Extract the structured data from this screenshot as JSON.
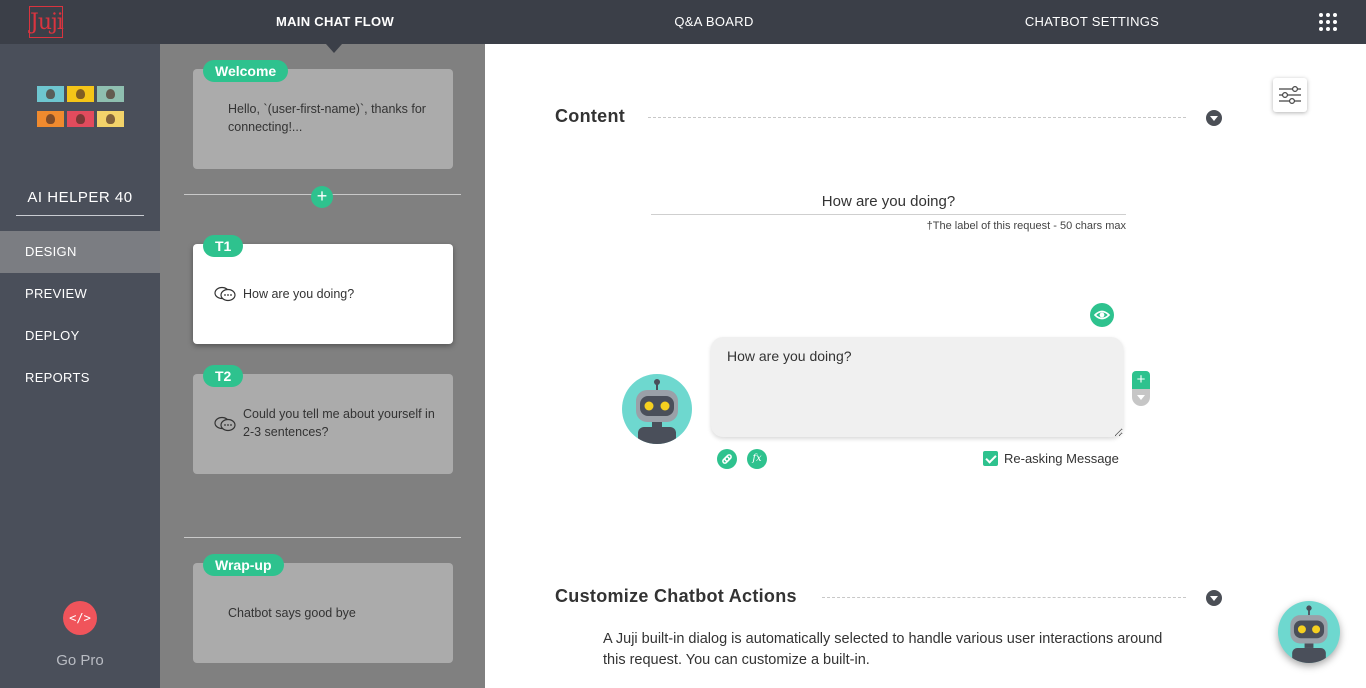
{
  "app": {
    "logo_text": "Juji"
  },
  "topnav": {
    "tabs": [
      {
        "label": "MAIN CHAT FLOW",
        "active": true
      },
      {
        "label": "Q&A BOARD",
        "active": false
      },
      {
        "label": "CHATBOT SETTINGS",
        "active": false
      }
    ],
    "apps_icon": "apps-grid-icon"
  },
  "sidebar": {
    "bot_name": "AI HELPER 40",
    "items": [
      {
        "label": "DESIGN",
        "active": true
      },
      {
        "label": "PREVIEW",
        "active": false
      },
      {
        "label": "DEPLOY",
        "active": false
      },
      {
        "label": "REPORTS",
        "active": false
      }
    ],
    "gopro": {
      "icon_text": "</>",
      "label": "Go Pro"
    },
    "avatar_colors": [
      "#6ec6d0",
      "#f5c518",
      "#8fbfb0",
      "#f08a2e",
      "#e24b5d",
      "#f3d36a"
    ]
  },
  "flow": {
    "cards": [
      {
        "tag": "Welcome",
        "text": "Hello, `(user-first-name)`, thanks for connecting!...",
        "has_chat_icon": false,
        "selected": false
      },
      {
        "tag": "T1",
        "text": "How are you doing?",
        "has_chat_icon": true,
        "selected": true
      },
      {
        "tag": "T2",
        "text": "Could you tell me about yourself in 2-3 sentences?",
        "has_chat_icon": true,
        "selected": false
      },
      {
        "tag": "Wrap-up",
        "text": "Chatbot says good bye",
        "has_chat_icon": false,
        "selected": false
      }
    ],
    "add_symbol": "+"
  },
  "content_section": {
    "title": "Content",
    "label_value": "How are you doing?",
    "label_hint": "†The label of this request - 50 chars max",
    "message_text": "How are you doing?",
    "add_symbol": "+",
    "function_symbol": "fx",
    "reasking_label": "Re-asking Message",
    "reasking_checked": true
  },
  "actions_section": {
    "title": "Customize Chatbot Actions",
    "description": "A Juji built-in dialog is automatically selected to handle various user interactions around this request. You can customize a built-in."
  },
  "colors": {
    "accent": "#2ec28e",
    "topbar": "#3b3f48",
    "sidebar": "#4a4f5a",
    "flow_bg": "#808080",
    "gopro": "#f0545b",
    "robot_bg": "#6ed8cf"
  }
}
